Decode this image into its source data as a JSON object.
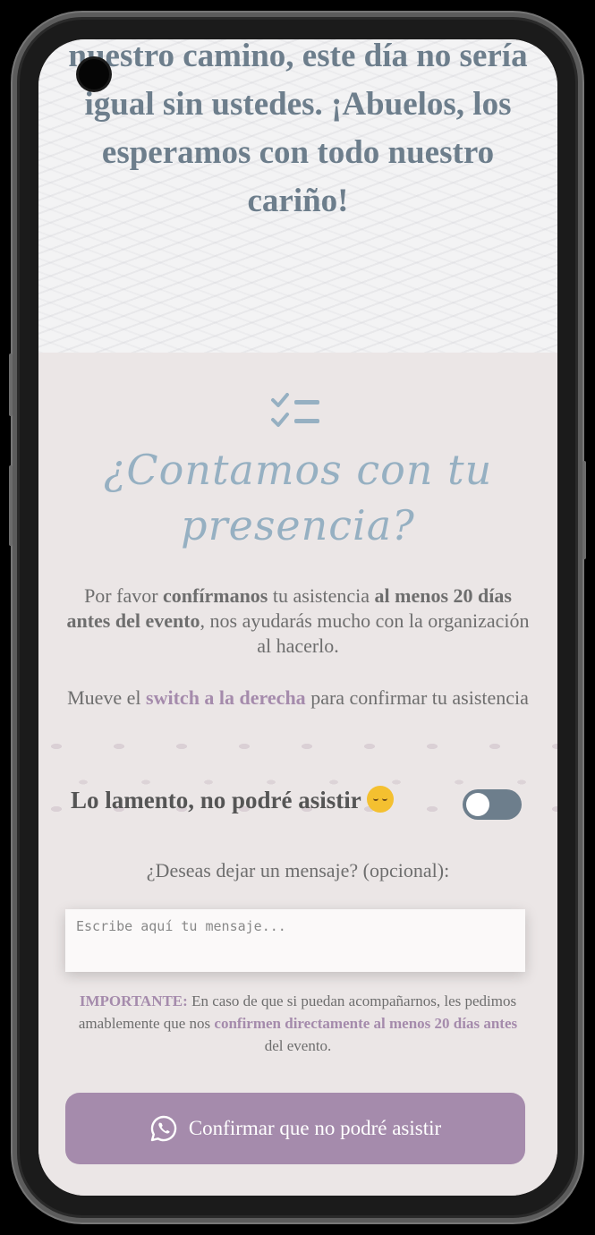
{
  "top": {
    "message": "nuestro camino, este día no sería igual sin ustedes. ¡Abuelos, los esperamos con todo nuestro cariño!"
  },
  "rsvp": {
    "icon": "checklist-icon",
    "title_line1": "¿Contamos con tu",
    "title_line2": "presencia?",
    "intro": {
      "part1": "Por favor ",
      "bold1": "confírmanos",
      "part2": " tu asistencia ",
      "bold2": "al menos 20 días antes del evento",
      "part3": ", nos ayudarás mucho con la organización al hacerlo."
    },
    "switch_hint": {
      "part1": "Mueve el ",
      "accent": "switch a la derecha",
      "part2": " para confirmar tu asistencia"
    },
    "decline_label": "Lo lamento, no podré asistir",
    "toggle_state": "off",
    "message_label": "¿Deseas dejar un mensaje? (opcional):",
    "message_placeholder": "Escribe aquí tu mensaje...",
    "important": {
      "label": "IMPORTANTE:",
      "part1": " En caso de que si puedan acompañarnos, les pedimos amablemente que nos ",
      "accent": "confirmen directamente al menos 20 días antes",
      "part2": " del evento."
    },
    "button_label": "Confirmar que no podré asistir",
    "button_icon": "whatsapp-icon"
  },
  "colors": {
    "accent": "#a58bac",
    "title_blue": "#96b0c2",
    "text_gray": "#6e6e6e",
    "slate": "#6d7e8c"
  }
}
